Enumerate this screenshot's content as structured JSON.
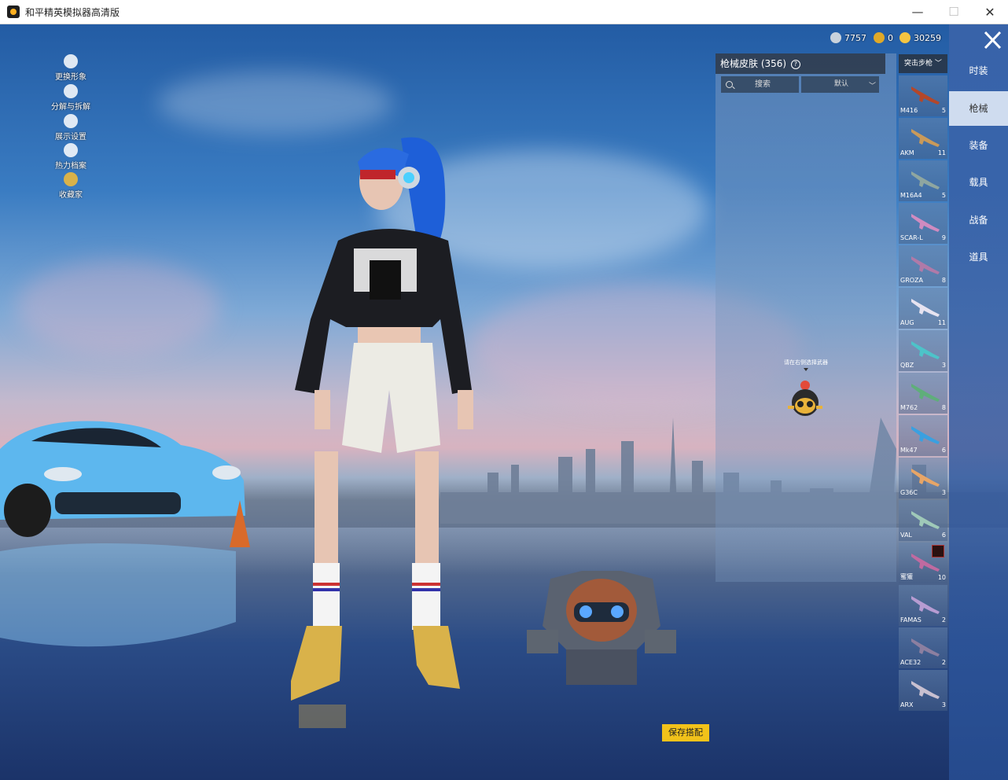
{
  "window": {
    "title": "和平精英模拟器高清版",
    "min_label": "—",
    "max_label": "☐",
    "close_label": "✕"
  },
  "left_menu": [
    {
      "label": "更换形象",
      "icon": "avatar-icon"
    },
    {
      "label": "分解与拆解",
      "icon": "puzzle-icon"
    },
    {
      "label": "展示设置",
      "icon": "eye-icon"
    },
    {
      "label": "热力档案",
      "icon": "flame-icon"
    },
    {
      "label": "收藏家",
      "icon": "collector-icon"
    }
  ],
  "currency": [
    {
      "value": "7757",
      "icon": "silver-coin-icon",
      "color": "#c9d2dc"
    },
    {
      "value": "0",
      "icon": "gold-medal-icon",
      "color": "#e0a928"
    },
    {
      "value": "30259",
      "icon": "gold-coin-icon",
      "color": "#f4c542"
    }
  ],
  "panel": {
    "title": "枪械皮肤 (356)",
    "help": "?",
    "search_label": "搜索",
    "sort_label": "默认",
    "hint": "请在右侧选择武器"
  },
  "category_select": "突击步枪",
  "weapons": [
    {
      "name": "M416",
      "count": "5",
      "color": "#b4472a"
    },
    {
      "name": "AKM",
      "count": "11",
      "color": "#c99a5a"
    },
    {
      "name": "M16A4",
      "count": "5",
      "color": "#8fa6a0"
    },
    {
      "name": "SCAR-L",
      "count": "9",
      "color": "#d08bc0"
    },
    {
      "name": "GROZA",
      "count": "8",
      "color": "#b07aa8"
    },
    {
      "name": "AUG",
      "count": "11",
      "color": "#e6e3f0"
    },
    {
      "name": "QBZ",
      "count": "3",
      "color": "#4dc3c9"
    },
    {
      "name": "M762",
      "count": "8",
      "color": "#5fae7a"
    },
    {
      "name": "Mk47",
      "count": "6",
      "color": "#3aa0e0"
    },
    {
      "name": "G36C",
      "count": "3",
      "color": "#e7a567"
    },
    {
      "name": "VAL",
      "count": "6",
      "color": "#9fc9b8"
    },
    {
      "name": "蜜獾",
      "count": "10",
      "color": "#c06aa0",
      "badge": true
    },
    {
      "name": "FAMAS",
      "count": "2",
      "color": "#b79cd2"
    },
    {
      "name": "ACE32",
      "count": "2",
      "color": "#8c7fa0"
    },
    {
      "name": "ARX",
      "count": "3",
      "color": "#c8c0d0"
    }
  ],
  "tabs": [
    {
      "label": "时装",
      "active": false
    },
    {
      "label": "枪械",
      "active": true
    },
    {
      "label": "装备",
      "active": false
    },
    {
      "label": "载具",
      "active": false
    },
    {
      "label": "战备",
      "active": false
    },
    {
      "label": "道具",
      "active": false
    }
  ],
  "save_button": "保存搭配"
}
